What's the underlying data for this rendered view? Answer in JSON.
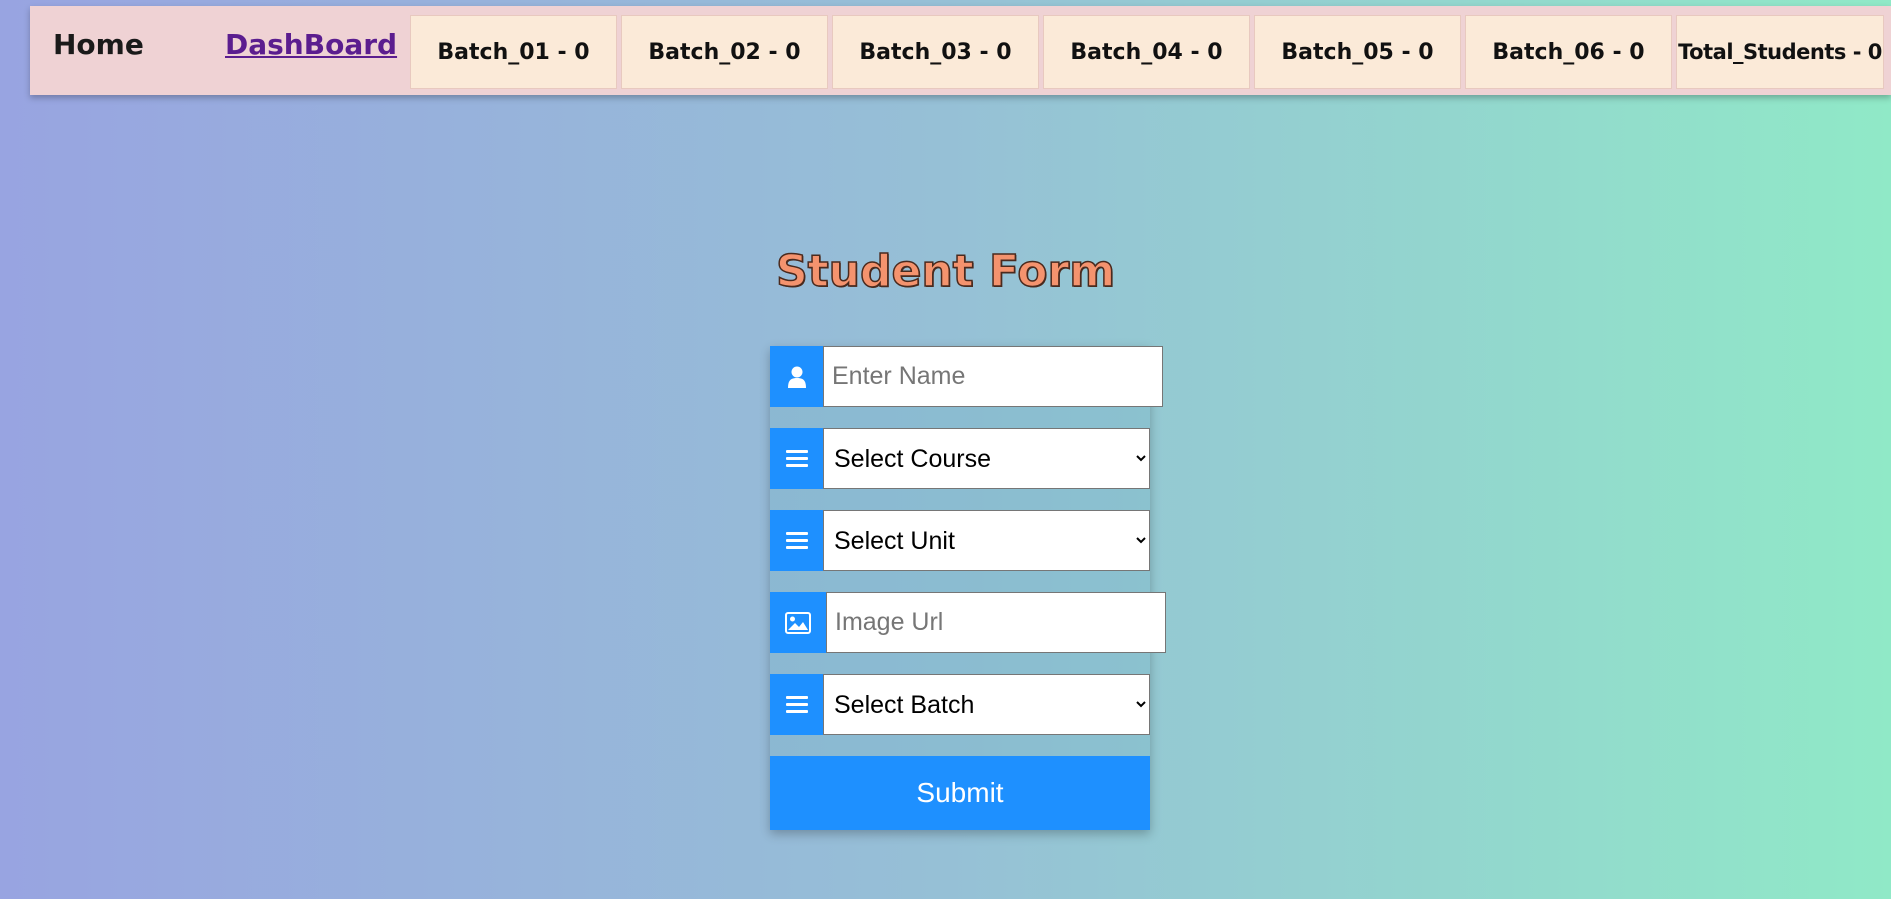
{
  "nav": {
    "home_label": "Home",
    "dashboard_label": "DashBoard",
    "batches": [
      {
        "label": "Batch_01 - 0"
      },
      {
        "label": "Batch_02 - 0"
      },
      {
        "label": "Batch_03 - 0"
      },
      {
        "label": "Batch_04 - 0"
      },
      {
        "label": "Batch_05 - 0"
      },
      {
        "label": "Batch_06 - 0"
      }
    ],
    "total_label": "Total_Students - 0"
  },
  "form": {
    "title": "Student Form",
    "name_placeholder": "Enter Name",
    "course_selected": "Select Course",
    "unit_selected": "Select Unit",
    "image_placeholder": "Image Url",
    "batch_selected": "Select Batch",
    "submit_label": "Submit",
    "icons": {
      "name": "user-icon",
      "course": "bars-icon",
      "unit": "bars-icon",
      "image": "image-icon",
      "batch": "bars-icon"
    }
  },
  "colors": {
    "accent": "#1e90ff",
    "nav_bg": "#efd2d4",
    "batch_bg": "#fbead8",
    "title": "#f4936e",
    "dashboard_link": "#5b1d8f"
  }
}
